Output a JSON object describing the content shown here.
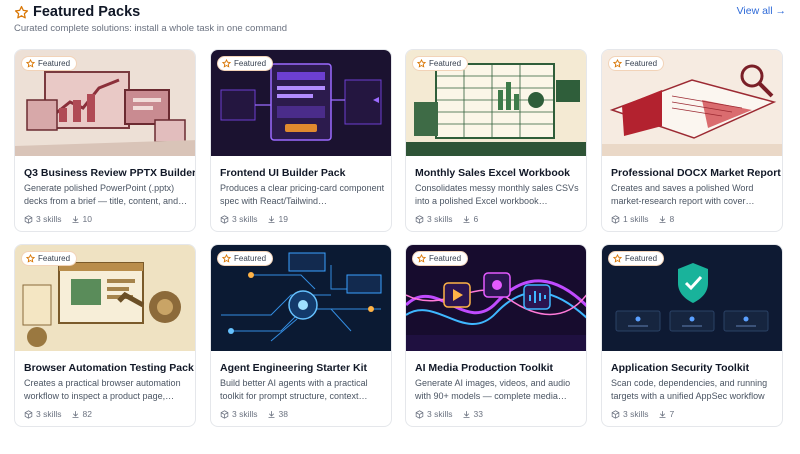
{
  "header": {
    "title": "Featured Packs",
    "subtitle": "Curated complete solutions: install a whole task in one command",
    "view_all": "View all →",
    "star_icon": "star-outline-icon",
    "accent": "#e08a2e"
  },
  "badge_label": "Featured",
  "packs": [
    {
      "name": "Q3 Business Review PPTX Builder",
      "description": "Generate polished PowerPoint (.pptx) decks from a brief — title, content, and…",
      "skills": "3 skills",
      "installs": "10",
      "image": "presentation-illustration"
    },
    {
      "name": "Frontend UI Builder Pack",
      "description": "Produces a clear pricing-card component spec with React/Tailwind…",
      "skills": "3 skills",
      "installs": "19",
      "image": "ui-wireframe-illustration"
    },
    {
      "name": "Monthly Sales Excel Workbook",
      "description": "Consolidates messy monthly sales CSVs into a polished Excel workbook…",
      "skills": "3 skills",
      "installs": "6",
      "image": "spreadsheet-illustration"
    },
    {
      "name": "Professional DOCX Market Report",
      "description": "Creates and saves a polished Word market-research report with cover…",
      "skills": "1 skills",
      "installs": "8",
      "image": "report-document-illustration"
    },
    {
      "name": "Browser Automation Testing Pack",
      "description": "Creates a practical browser automation workflow to inspect a product page,…",
      "skills": "3 skills",
      "installs": "82",
      "image": "robot-browser-illustration"
    },
    {
      "name": "Agent Engineering Starter Kit",
      "description": "Build better AI agents with a practical toolkit for prompt structure, context…",
      "skills": "3 skills",
      "installs": "38",
      "image": "circuit-agent-illustration"
    },
    {
      "name": "AI Media Production Toolkit",
      "description": "Generate AI images, videos, and audio with 90+ models — complete media…",
      "skills": "3 skills",
      "installs": "33",
      "image": "media-waves-illustration"
    },
    {
      "name": "Application Security Toolkit",
      "description": "Scan code, dependencies, and running targets with a unified AppSec workflow",
      "skills": "3 skills",
      "installs": "7",
      "image": "security-shield-illustration"
    }
  ]
}
